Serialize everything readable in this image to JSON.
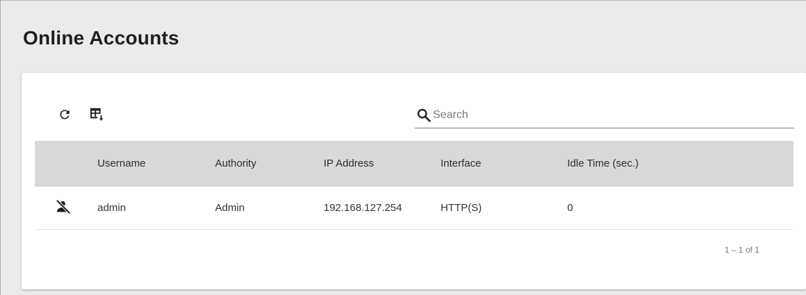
{
  "page": {
    "title": "Online Accounts"
  },
  "toolbar": {
    "refresh_icon": "refresh-icon",
    "export_icon": "table-export-icon"
  },
  "search": {
    "placeholder": "Search",
    "value": ""
  },
  "table": {
    "columns": [
      "Username",
      "Authority",
      "IP Address",
      "Interface",
      "Idle Time (sec.)"
    ],
    "rows": [
      {
        "icon": "disconnect-user-icon",
        "username": "admin",
        "authority": "Admin",
        "ip_address": "192.168.127.254",
        "interface": "HTTP(S)",
        "idle_time": "0"
      }
    ]
  },
  "pagination": {
    "range_label": "1 – 1 of 1"
  },
  "colors": {
    "background": "#ebebeb",
    "card": "#ffffff",
    "header_row": "#d9d9d9",
    "icon": "#222222"
  }
}
